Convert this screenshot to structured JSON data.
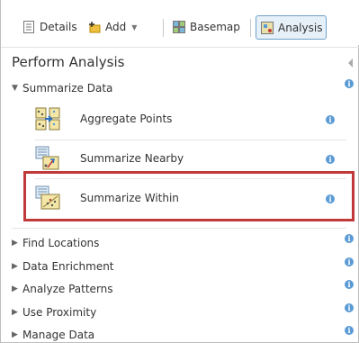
{
  "toolbar": {
    "details": "Details",
    "add": "Add",
    "basemap": "Basemap",
    "analysis": "Analysis"
  },
  "panel": {
    "title": "Perform Analysis"
  },
  "summarize": {
    "label": "Summarize Data",
    "tools": [
      {
        "label": "Aggregate Points",
        "icon": "aggregate-points-icon"
      },
      {
        "label": "Summarize Nearby",
        "icon": "summarize-nearby-icon"
      },
      {
        "label": "Summarize Within",
        "icon": "summarize-within-icon"
      }
    ]
  },
  "sections": [
    {
      "label": "Find Locations"
    },
    {
      "label": "Data Enrichment"
    },
    {
      "label": "Analyze Patterns"
    },
    {
      "label": "Use Proximity"
    },
    {
      "label": "Manage Data"
    }
  ],
  "colors": {
    "highlight": "#c0393b",
    "info": "#5b9bd5",
    "active_tab": "#e6f0f8"
  }
}
